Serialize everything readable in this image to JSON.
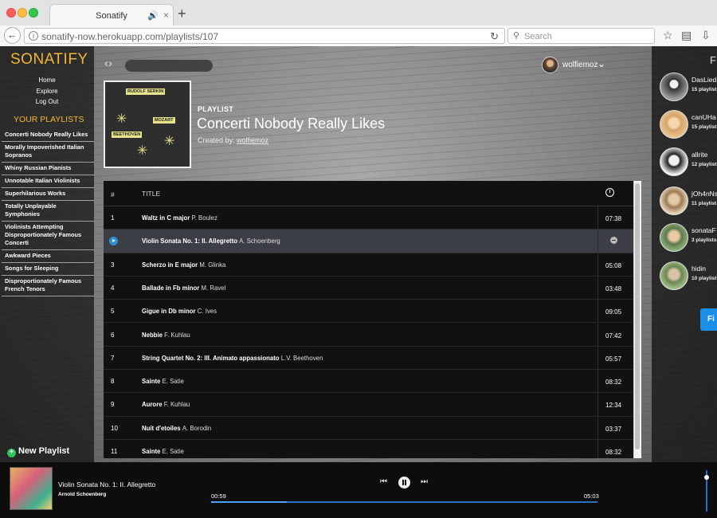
{
  "browser": {
    "tab_title": "Sonatify",
    "tab_audio_icon": "speaker-icon",
    "url": "sonatify-now.herokuapp.com/playlists/107",
    "search_placeholder": "Search"
  },
  "sidebar": {
    "logo": "SONATIFY",
    "nav": [
      "Home",
      "Explore",
      "Log Out"
    ],
    "playlists_heading": "YOUR PLAYLISTS",
    "playlists": [
      "Concerti Nobody Really Likes",
      "Morally Impoverished Italian Sopranos",
      "Whiny Russian Pianists",
      "Unnotable Italian Violinists",
      "Superhilarious Works",
      "Totally Unplayable Symphonies",
      "Violinists Attempting Disproportionately Famous Concerti",
      "Awkward Pieces",
      "Songs for Sleeping",
      "Disproportionately Famous French Tenors"
    ],
    "new_playlist": "New Playlist"
  },
  "topbar": {
    "username": "wolfiemoz"
  },
  "album_art": {
    "labels": [
      "RUDOLF SERKIN",
      "MOZART",
      "BEETHOVEN"
    ]
  },
  "playlist": {
    "kind": "PLAYLIST",
    "title": "Concerti Nobody Really Likes",
    "created_by_label": "Created by:",
    "owner": "wolfiemoz"
  },
  "table": {
    "header_num": "#",
    "header_title": "TITLE",
    "tracks": [
      {
        "num": "1",
        "title": "Waltz in C major",
        "artist": "P. Boulez",
        "time": "07:38"
      },
      {
        "num": "2",
        "title": "Violin Sonata No. 1: II. Allegretto",
        "artist": "A. Schoenberg",
        "time": ""
      },
      {
        "num": "3",
        "title": "Scherzo in E major",
        "artist": "M. Glinka",
        "time": "05:08"
      },
      {
        "num": "4",
        "title": "Ballade in Fb minor",
        "artist": "M. Ravel",
        "time": "03:48"
      },
      {
        "num": "5",
        "title": "Gigue in Db minor",
        "artist": "C. Ives",
        "time": "09:05"
      },
      {
        "num": "6",
        "title": "Nebbie",
        "artist": "F. Kuhlau",
        "time": "07:42"
      },
      {
        "num": "7",
        "title": "String Quartet No. 2: III. Animato appassionato",
        "artist": "L.V. Beethoven",
        "time": "05:57"
      },
      {
        "num": "8",
        "title": "Sainte",
        "artist": "E. Satie",
        "time": "08:32"
      },
      {
        "num": "9",
        "title": "Aurore",
        "artist": "F. Kuhlau",
        "time": "12:34"
      },
      {
        "num": "10",
        "title": "Nuit d'etoiles",
        "artist": "A. Borodin",
        "time": "03:37"
      },
      {
        "num": "11",
        "title": "Sainte",
        "artist": "E. Satie",
        "time": "08:32"
      }
    ]
  },
  "friends": {
    "heading": "F",
    "people": [
      {
        "name": "DasLied",
        "count": "15 playlist"
      },
      {
        "name": "canUHa",
        "count": "15 playlist"
      },
      {
        "name": "allrite",
        "count": "12 playlist"
      },
      {
        "name": "jOh4nNs",
        "count": "11 playlist"
      },
      {
        "name": "sonataF",
        "count": "3 playlists"
      },
      {
        "name": "hidin",
        "count": "10 playlist"
      }
    ],
    "find_button": "Fi"
  },
  "player": {
    "track_title": "Violin Sonata No. 1: II. Allegretto",
    "track_artist": "Arnold Schoenberg",
    "current_time": "00:59",
    "total_time": "05:03",
    "progress_fraction": 0.195,
    "volume_fraction": 0.82
  },
  "colors": {
    "accent": "#f2b632",
    "play_blue": "#2e8fd4",
    "find_blue": "#1b8fe8",
    "new_playlist_green": "#2ec85a"
  }
}
